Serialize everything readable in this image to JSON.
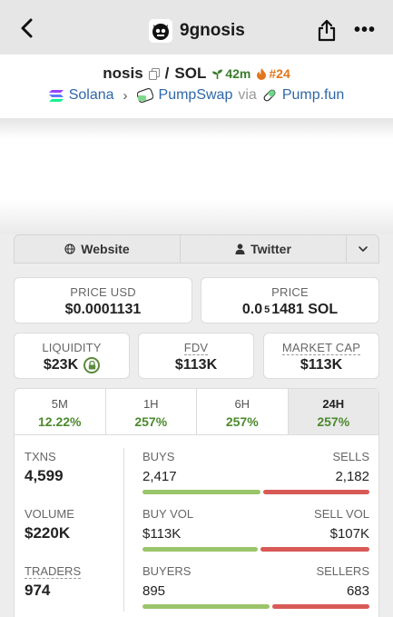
{
  "nav": {
    "title": "9gnosis"
  },
  "pair": {
    "base": "nosis",
    "separator": "/",
    "quote": "SOL",
    "age": "42m",
    "rank": "#24"
  },
  "route": {
    "chain": "Solana",
    "dex": "PumpSwap",
    "via": "via",
    "launchpad": "Pump.fun"
  },
  "links": {
    "website": "Website",
    "twitter": "Twitter"
  },
  "price": {
    "usd_label": "PRICE USD",
    "usd_value": "$0.0001131",
    "native_label": "PRICE",
    "native_prefix": "0.0",
    "native_zeros": "5",
    "native_digits": "1481 SOL"
  },
  "metrics": {
    "liquidity_label": "LIQUIDITY",
    "liquidity_value": "$23K",
    "fdv_label": "FDV",
    "fdv_value": "$113K",
    "mcap_label": "MARKET CAP",
    "mcap_value": "$113K"
  },
  "timeframes": [
    {
      "label": "5M",
      "change": "12.22%"
    },
    {
      "label": "1H",
      "change": "257%"
    },
    {
      "label": "6H",
      "change": "257%"
    },
    {
      "label": "24H",
      "change": "257%",
      "active": true
    }
  ],
  "stats": {
    "txns_label": "TXNS",
    "txns_value": "4,599",
    "buys_label": "BUYS",
    "buys_value": "2,417",
    "sells_label": "SELLS",
    "sells_value": "2,182",
    "buys_share": 0.526,
    "volume_label": "VOLUME",
    "volume_value": "$220K",
    "buyvol_label": "BUY VOL",
    "buyvol_value": "$113K",
    "sellvol_label": "SELL VOL",
    "sellvol_value": "$107K",
    "buyvol_share": 0.514,
    "traders_label": "TRADERS",
    "traders_value": "974",
    "buyers_label": "BUYERS",
    "buyers_value": "895",
    "sellers_label": "SELLERS",
    "sellers_value": "683",
    "buyers_share": 0.567
  },
  "colors": {
    "positive": "#4c8a2d",
    "buy_bar": "#9ac56a",
    "sell_bar": "#d85a57",
    "link": "#2f66a8",
    "age": "#3a7d2c",
    "rank": "#e2761b"
  },
  "icons": [
    "back-arrow-icon",
    "avatar-logo",
    "share-icon",
    "more-icon",
    "copy-icon",
    "sprout-icon",
    "flame-icon",
    "solana-icon",
    "pumpswap-icon",
    "pill-icon",
    "globe-icon",
    "person-icon",
    "chevron-down-icon",
    "lock-icon"
  ]
}
